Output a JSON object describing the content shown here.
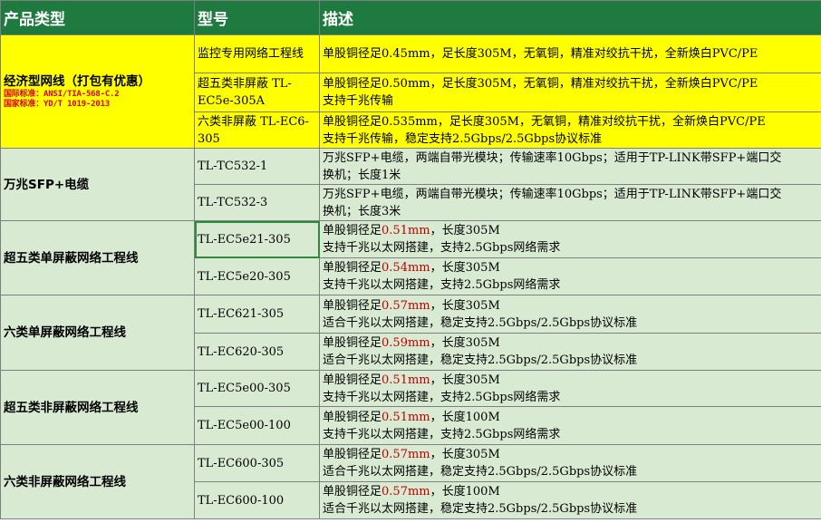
{
  "header": {
    "category": "产品类型",
    "model": "型号",
    "description": "描述"
  },
  "groups": [
    {
      "category": "经济型网线（打包有优惠）",
      "standards": [
        "国际标准：ANSI/TIA-568-C.2",
        "国家标准：YD/T 1019-2013"
      ],
      "rows": [
        {
          "model": "监控专用网络工程线",
          "desc_lines": [
            [
              "单股铜径足0.45mm，足长度305M，无氧铜，精准对绞抗干扰，全新焕白PVC/PE"
            ]
          ]
        },
        {
          "model": "超五类非屏蔽 TL-EC5e-305A",
          "desc_lines": [
            [
              "单股铜径足0.50mm，足长度305M，无氧铜，精准对绞抗干扰，全新焕白PVC/PE"
            ],
            [
              "支持千兆传输"
            ]
          ]
        },
        {
          "model": "六类非屏蔽 TL-EC6-305",
          "desc_lines": [
            [
              "单股铜径足0.535mm，足长度305M，无氧铜，精准对绞抗干扰，全新焕白PVC/PE"
            ],
            [
              "支持千兆传输，稳定支持2.5Gbps/2.5Gbps协议标准"
            ]
          ]
        }
      ]
    },
    {
      "category": "万兆SFP+电缆",
      "rows": [
        {
          "model": "TL-TC532-1",
          "desc_lines": [
            [
              "万兆SFP+电缆，两端自带光模块；传输速率10Gbps；适用于TP-LINK带SFP+端口交"
            ],
            [
              "换机；长度1米"
            ]
          ]
        },
        {
          "model": "TL-TC532-3",
          "desc_lines": [
            [
              "万兆SFP+电缆，两端自带光模块；传输速率10Gbps；适用于TP-LINK带SFP+端口交"
            ],
            [
              "换机；长度3米"
            ]
          ]
        }
      ]
    },
    {
      "category": "超五类单屏蔽网络工程线",
      "rows": [
        {
          "model": "TL-EC5e21-305",
          "desc_lines": [
            [
              "单股铜径足",
              "0.51mm",
              "，长度305M"
            ],
            [
              "支持千兆以太网搭建，支持2.5Gbps网络需求"
            ]
          ]
        },
        {
          "model": "TL-EC5e20-305",
          "desc_lines": [
            [
              "单股铜径足",
              "0.54mm",
              "，长度305M"
            ],
            [
              "支持千兆以太网搭建，支持2.5Gbps网络需求"
            ]
          ]
        }
      ]
    },
    {
      "category": "六类单屏蔽网络工程线",
      "rows": [
        {
          "model": "TL-EC621-305",
          "desc_lines": [
            [
              "单股铜径足",
              "0.57mm",
              "，长度305M"
            ],
            [
              "适合千兆以太网搭建，稳定支持2.5Gbps/2.5Gbps协议标准"
            ]
          ]
        },
        {
          "model": "TL-EC620-305",
          "desc_lines": [
            [
              "单股铜径足",
              "0.59mm",
              "，长度305M"
            ],
            [
              "适合千兆以太网搭建，稳定支持2.5Gbps/2.5Gbps协议标准"
            ]
          ]
        }
      ]
    },
    {
      "category": "超五类非屏蔽网络工程线",
      "rows": [
        {
          "model": "TL-EC5e00-305",
          "desc_lines": [
            [
              "单股铜径足",
              "0.51mm",
              "，长度305M"
            ],
            [
              "支持千兆以太网搭建，支持2.5Gbps网络需求"
            ]
          ]
        },
        {
          "model": "TL-EC5e00-100",
          "desc_lines": [
            [
              "单股铜径足",
              "0.51mm",
              "，长度100M"
            ],
            [
              "支持千兆以太网搭建，支持2.5Gbps网络需求"
            ]
          ]
        }
      ]
    },
    {
      "category": "六类非屏蔽网络工程线",
      "rows": [
        {
          "model": "TL-EC600-305",
          "desc_lines": [
            [
              "单股铜径足",
              "0.57mm",
              "，长度305M"
            ],
            [
              "适合千兆以太网搭建，稳定支持2.5Gbps/2.5Gbps协议标准"
            ]
          ]
        },
        {
          "model": "TL-EC600-100",
          "desc_lines": [
            [
              "单股铜径足",
              "0.57mm",
              "，长度100M"
            ],
            [
              "适合千兆以太网搭建，稳定支持2.5Gbps/2.5Gbps协议标准"
            ]
          ]
        }
      ]
    }
  ],
  "colors": {
    "header_bg": "#1f7a3f",
    "economy_bg": "#ffff00",
    "row_bg": "#d9ead3",
    "highlight": "#c00000",
    "standard_text": "#e0001b"
  }
}
